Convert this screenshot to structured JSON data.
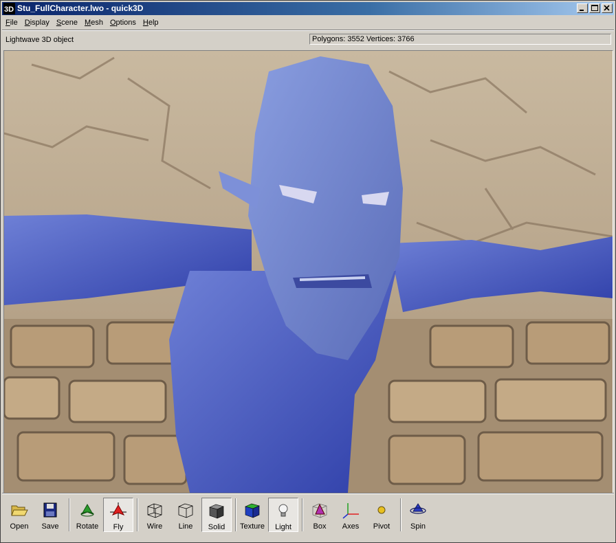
{
  "window": {
    "app_icon_text": "3D",
    "title": "Stu_FullCharacter.lwo - quick3D",
    "buttons": [
      "minimize",
      "maximize",
      "close"
    ]
  },
  "menu": {
    "items": [
      {
        "label": "File",
        "mnemonic": "F",
        "rest": "ile"
      },
      {
        "label": "Display",
        "mnemonic": "D",
        "rest": "isplay"
      },
      {
        "label": "Scene",
        "mnemonic": "S",
        "rest": "cene"
      },
      {
        "label": "Mesh",
        "mnemonic": "M",
        "rest": "esh"
      },
      {
        "label": "Options",
        "mnemonic": "O",
        "rest": "ptions"
      },
      {
        "label": "Help",
        "mnemonic": "H",
        "rest": "elp"
      }
    ]
  },
  "status": {
    "file_type": "Lightwave 3D object",
    "mesh_stats": "Polygons: 3552  Vertices: 3766"
  },
  "viewport": {
    "scene": "blue character model over stone wall",
    "model_color": "#5a6fc4",
    "background_color": "#b9a88f"
  },
  "toolbar": {
    "open": "Open",
    "save": "Save",
    "rotate": "Rotate",
    "fly": "Fly",
    "wire": "Wire",
    "line": "Line",
    "solid": "Solid",
    "texture": "Texture",
    "light": "Light",
    "box": "Box",
    "axes": "Axes",
    "pivot": "Pivot",
    "spin": "Spin"
  }
}
